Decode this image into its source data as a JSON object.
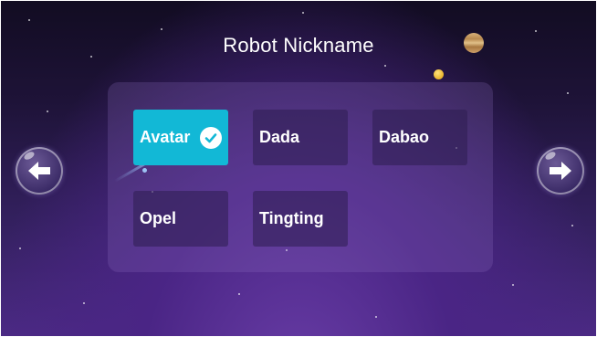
{
  "screen": {
    "title": "Robot Nickname"
  },
  "options": [
    {
      "label": "Avatar",
      "selected": true
    },
    {
      "label": "Dada",
      "selected": false
    },
    {
      "label": "Dabao",
      "selected": false
    },
    {
      "label": "Opel",
      "selected": false
    },
    {
      "label": "Tingting",
      "selected": false
    }
  ],
  "navigation": {
    "prev_icon": "arrow-left-icon",
    "next_icon": "arrow-right-icon"
  },
  "colors": {
    "selected_accent": "#12b8d6",
    "background_top": "#120c22",
    "background_bottom": "#4b2a84"
  }
}
